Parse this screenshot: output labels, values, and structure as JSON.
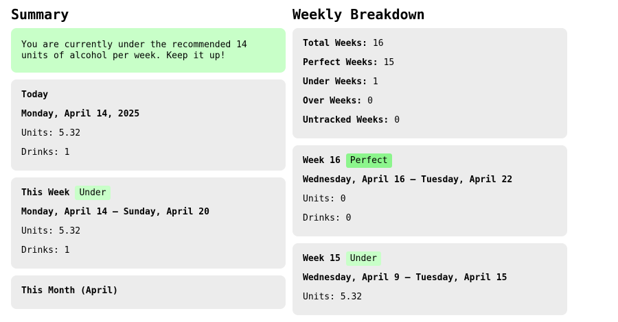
{
  "summary": {
    "title": "Summary",
    "notice": "You are currently under the recommended 14 units of alcohol per week. Keep it up!",
    "today": {
      "title": "Today",
      "date": "Monday, April 14, 2025",
      "units_label": "Units:",
      "units": "5.32",
      "drinks_label": "Drinks:",
      "drinks": "1"
    },
    "this_week": {
      "title": "This Week",
      "badge": "Under",
      "range": "Monday, April 14 – Sunday, April 20",
      "units_label": "Units:",
      "units": "5.32",
      "drinks_label": "Drinks:",
      "drinks": "1"
    },
    "this_month": {
      "title": "This Month (April)"
    }
  },
  "weekly": {
    "title": "Weekly Breakdown",
    "stats": [
      {
        "label": "Total Weeks:",
        "value": "16"
      },
      {
        "label": "Perfect Weeks:",
        "value": "15"
      },
      {
        "label": "Under Weeks:",
        "value": "1"
      },
      {
        "label": "Over Weeks:",
        "value": "0"
      },
      {
        "label": "Untracked Weeks:",
        "value": "0"
      }
    ],
    "weeks": [
      {
        "title": "Week 16",
        "badge": "Perfect",
        "range": "Wednesday, April 16 – Tuesday, April 22",
        "units_label": "Units:",
        "units": "0",
        "drinks_label": "Drinks:",
        "drinks": "0"
      },
      {
        "title": "Week 15",
        "badge": "Under",
        "range": "Wednesday, April 9 – Tuesday, April 15",
        "units_label": "Units:",
        "units": "5.32"
      }
    ]
  },
  "colors": {
    "card": "#ececec",
    "notice": "#c8ffc8",
    "badge_under": "#c8ffc8",
    "badge_perfect": "#8cf58c"
  }
}
